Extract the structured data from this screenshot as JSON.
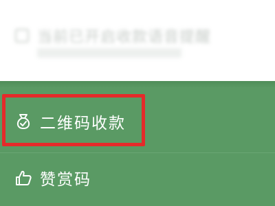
{
  "background_blurred": {
    "title": "当前已开启收款语音提醒"
  },
  "menu": {
    "items": [
      {
        "label": "二维码收款",
        "icon": "money-bag-icon"
      },
      {
        "label": "赞赏码",
        "icon": "thumbs-up-icon"
      }
    ]
  },
  "colors": {
    "panel": "#5a9a64",
    "highlight": "#e52a2a",
    "text": "#ffffff"
  }
}
